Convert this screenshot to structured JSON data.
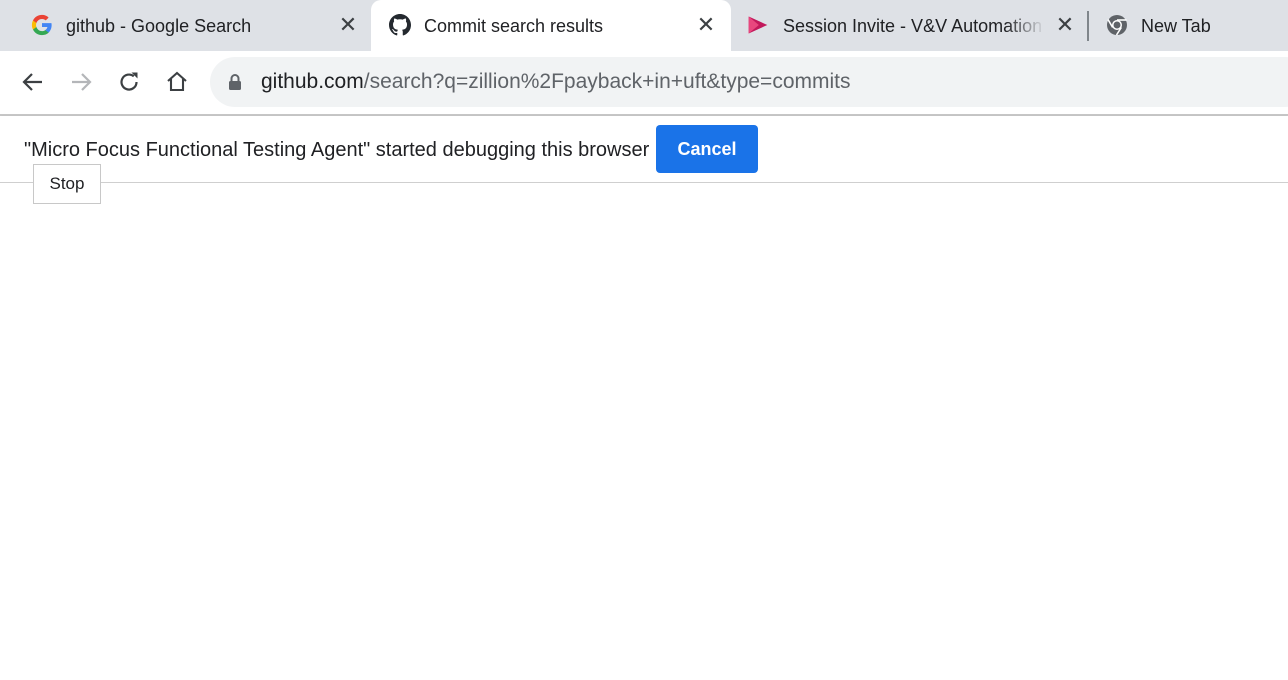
{
  "tabs": [
    {
      "title": "github - Google Search",
      "favicon": "google-g-icon",
      "active": false
    },
    {
      "title": "Commit search results",
      "favicon": "github-octocat-icon",
      "active": true
    },
    {
      "title": "Session Invite - V&V Automation",
      "favicon": "stream-play-icon",
      "active": false
    },
    {
      "title": "New Tab",
      "favicon": "chrome-icon",
      "active": false
    }
  ],
  "omnibox": {
    "host": "github.com",
    "path": "/search?q=zillion%2Fpayback+in+uft&type=commits"
  },
  "infobar": {
    "message": "\"Micro Focus Functional Testing Agent\" started debugging this browser",
    "cancel_label": "Cancel"
  },
  "tooltip": {
    "label": "Stop"
  },
  "colors": {
    "tabstrip_bg": "#dee1e6",
    "accent_blue": "#1a73e8",
    "omnibox_bg": "#f1f3f4"
  }
}
